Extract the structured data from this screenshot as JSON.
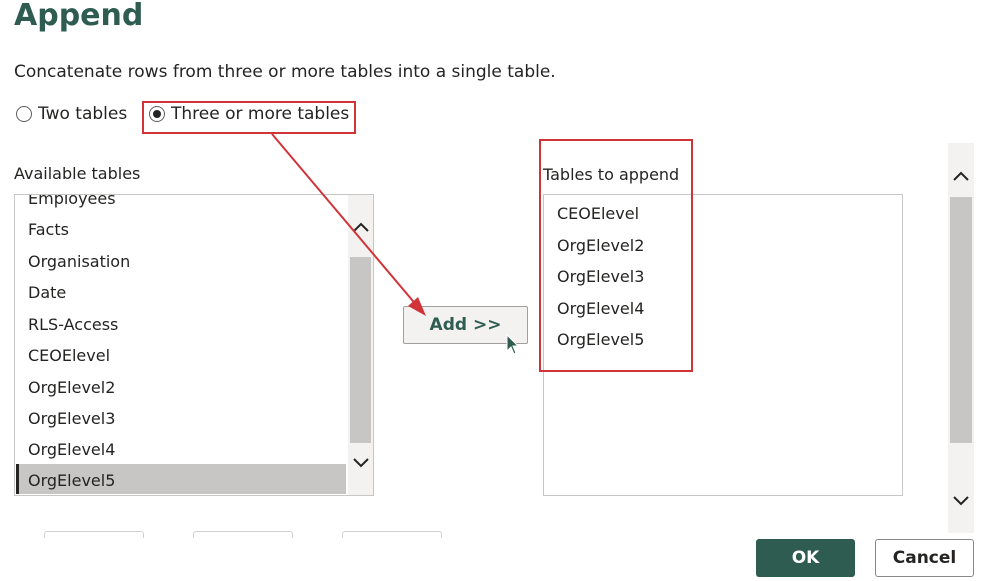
{
  "dialog": {
    "title": "Append",
    "description": "Concatenate rows from three or more tables into a single table."
  },
  "mode": {
    "options": [
      {
        "label": "Two tables",
        "selected": false
      },
      {
        "label": "Three or more tables",
        "selected": true
      }
    ]
  },
  "available": {
    "label": "Available tables",
    "items": [
      "Employees",
      "Facts",
      "Organisation",
      "Date",
      "RLS-Access",
      "CEOElevel",
      "OrgElevel2",
      "OrgElevel3",
      "OrgElevel4",
      "OrgElevel5"
    ],
    "selected": "OrgElevel5"
  },
  "add_button": {
    "label": "Add >>"
  },
  "append": {
    "label": "Tables to append",
    "items": [
      "CEOElevel",
      "OrgElevel2",
      "OrgElevel3",
      "OrgElevel4",
      "OrgElevel5"
    ]
  },
  "footer": {
    "ok_label": "OK",
    "cancel_label": "Cancel"
  },
  "colors": {
    "accent": "#2e5c50",
    "annotation": "#d13438"
  },
  "icons": {
    "cursor": "mouse-pointer-icon",
    "up": "chevron-up-icon",
    "down": "chevron-down-icon"
  }
}
